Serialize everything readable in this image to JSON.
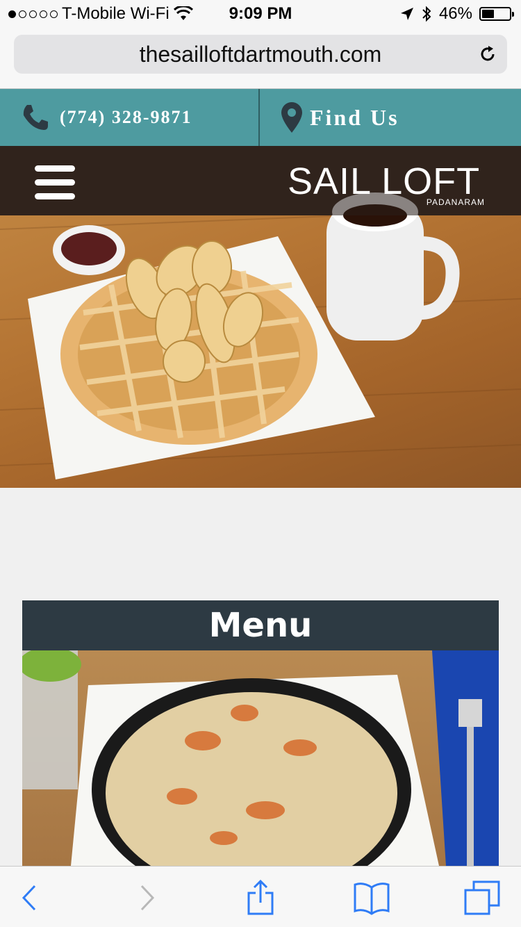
{
  "status": {
    "carrier": "T-Mobile Wi-Fi",
    "time": "9:09 PM",
    "battery": "46%",
    "battery_level": 0.46,
    "signal_bars_filled": 1
  },
  "browser": {
    "url": "thesailloftdartmouth.com"
  },
  "contact": {
    "phone": "(774) 328-9871",
    "find_us": "Find Us"
  },
  "header": {
    "logo_text": "SAIL LOFT",
    "logo_subtitle": "PADANARAM"
  },
  "menu_section": {
    "title": "Menu"
  },
  "colors": {
    "contact_bar": "#4e9ba0",
    "menu_header": "#2d3a43",
    "ios_blue": "#2f7cf6"
  }
}
